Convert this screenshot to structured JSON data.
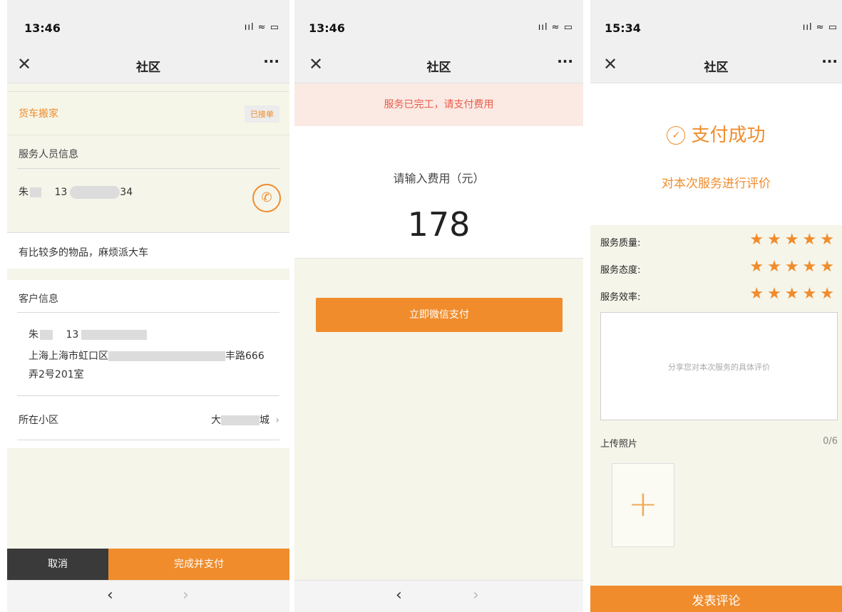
{
  "screen1": {
    "time": "13:46",
    "signal": "ııl ≈ ▭",
    "nav": {
      "close": "✕",
      "title": "社区",
      "more": "···"
    },
    "order": {
      "name": "货车搬家",
      "status": "已接单"
    },
    "staff_section": "服务人员信息",
    "staff": {
      "name": "朱",
      "phone_prefix": "13",
      "phone_suffix": "34"
    },
    "note": "有比较多的物品，麻烦派大车",
    "customer_section": "客户信息",
    "customer": {
      "name": "朱",
      "phone_prefix": "13",
      "address_line1_a": "上海上海市虹口区",
      "address_line1_b": "丰路666",
      "address_line2": "弄2号201室"
    },
    "community_label": "所在小区",
    "community_value_a": "大",
    "community_value_b": "城",
    "cancel": "取消",
    "complete_pay": "完成并支付",
    "browser": {
      "back": "‹",
      "forward": "›"
    }
  },
  "screen2": {
    "time": "13:46",
    "signal": "ııl ≈ ▭",
    "nav": {
      "close": "✕",
      "title": "社区",
      "more": "···"
    },
    "banner": "服务已完工，请支付费用",
    "fee_label": "请输入费用（元）",
    "amount": "178",
    "pay_button": "立即微信支付",
    "browser": {
      "back": "‹",
      "forward": "›"
    }
  },
  "screen3": {
    "time": "15:34",
    "signal": "ııl ≈ ▭",
    "nav": {
      "close": "✕",
      "title": "社区",
      "more": "···"
    },
    "success": "支付成功",
    "rate_prompt": "对本次服务进行评价",
    "ratings": [
      {
        "label": "服务质量:",
        "stars": "★★★★★",
        "value": 5
      },
      {
        "label": "服务态度:",
        "stars": "★★★★★",
        "value": 5
      },
      {
        "label": "服务效率:",
        "stars": "★★★★★",
        "value": 5
      }
    ],
    "comment_placeholder": "分享您对本次服务的具体评价",
    "upload_label": "上传照片",
    "upload_count": "0/6",
    "add_photo": "+",
    "submit": "发表评论"
  },
  "colors": {
    "accent": "#f08c2c",
    "banner_text": "#e85b4a",
    "page_bg": "#f5f5ea"
  }
}
